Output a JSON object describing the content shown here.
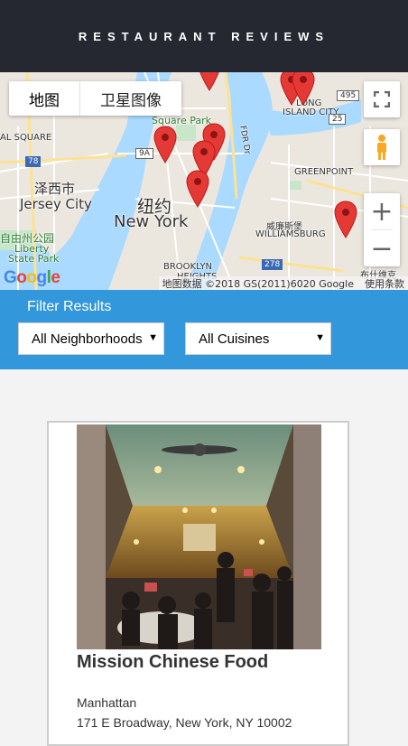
{
  "header": {
    "title": "RESTAURANT REVIEWS"
  },
  "map": {
    "type_map_label": "地图",
    "type_satellite_label": "卫星图像",
    "attribution": "地图数据 ©2018 GS(2011)6020 Google",
    "terms": "使用条款",
    "logo": "Google",
    "labels": {
      "nyc_cn": "纽约",
      "nyc_en": "New York",
      "jersey_cn": "泽西市",
      "jersey_en": "Jersey City",
      "liberty_cn": "自由州公园",
      "liberty_en1": "Liberty",
      "liberty_en2": "State Park",
      "williamsburg_cn": "威廉斯堡",
      "williamsburg_en": "WILLIAMSBURG",
      "greenpoint": "GREENPOINT",
      "long_island_1": "LONG",
      "long_island_2": "ISLAND CITY",
      "square_park": "Square Park",
      "brooklyn": "BROOKLYN",
      "heights": "HEIGHTS",
      "square": "AL SQUARE",
      "fdr": "FDR Dr",
      "bushwick": "布什维克",
      "route_78": "78",
      "route_278": "278",
      "route_9a": "9A",
      "route_495": "495",
      "route_25": "25"
    },
    "zoom_in": "+",
    "zoom_out": "−",
    "marker_color": "#e53935"
  },
  "filter": {
    "title": "Filter Results",
    "neighborhoods": "All Neighborhoods",
    "cuisines": "All Cuisines"
  },
  "restaurant": {
    "name": "Mission Chinese Food",
    "neighborhood": "Manhattan",
    "address": "171 E Broadway, New York, NY 10002"
  },
  "colors": {
    "header_bg": "#252831",
    "filter_bg": "#3397db",
    "water": "#aadaff"
  }
}
